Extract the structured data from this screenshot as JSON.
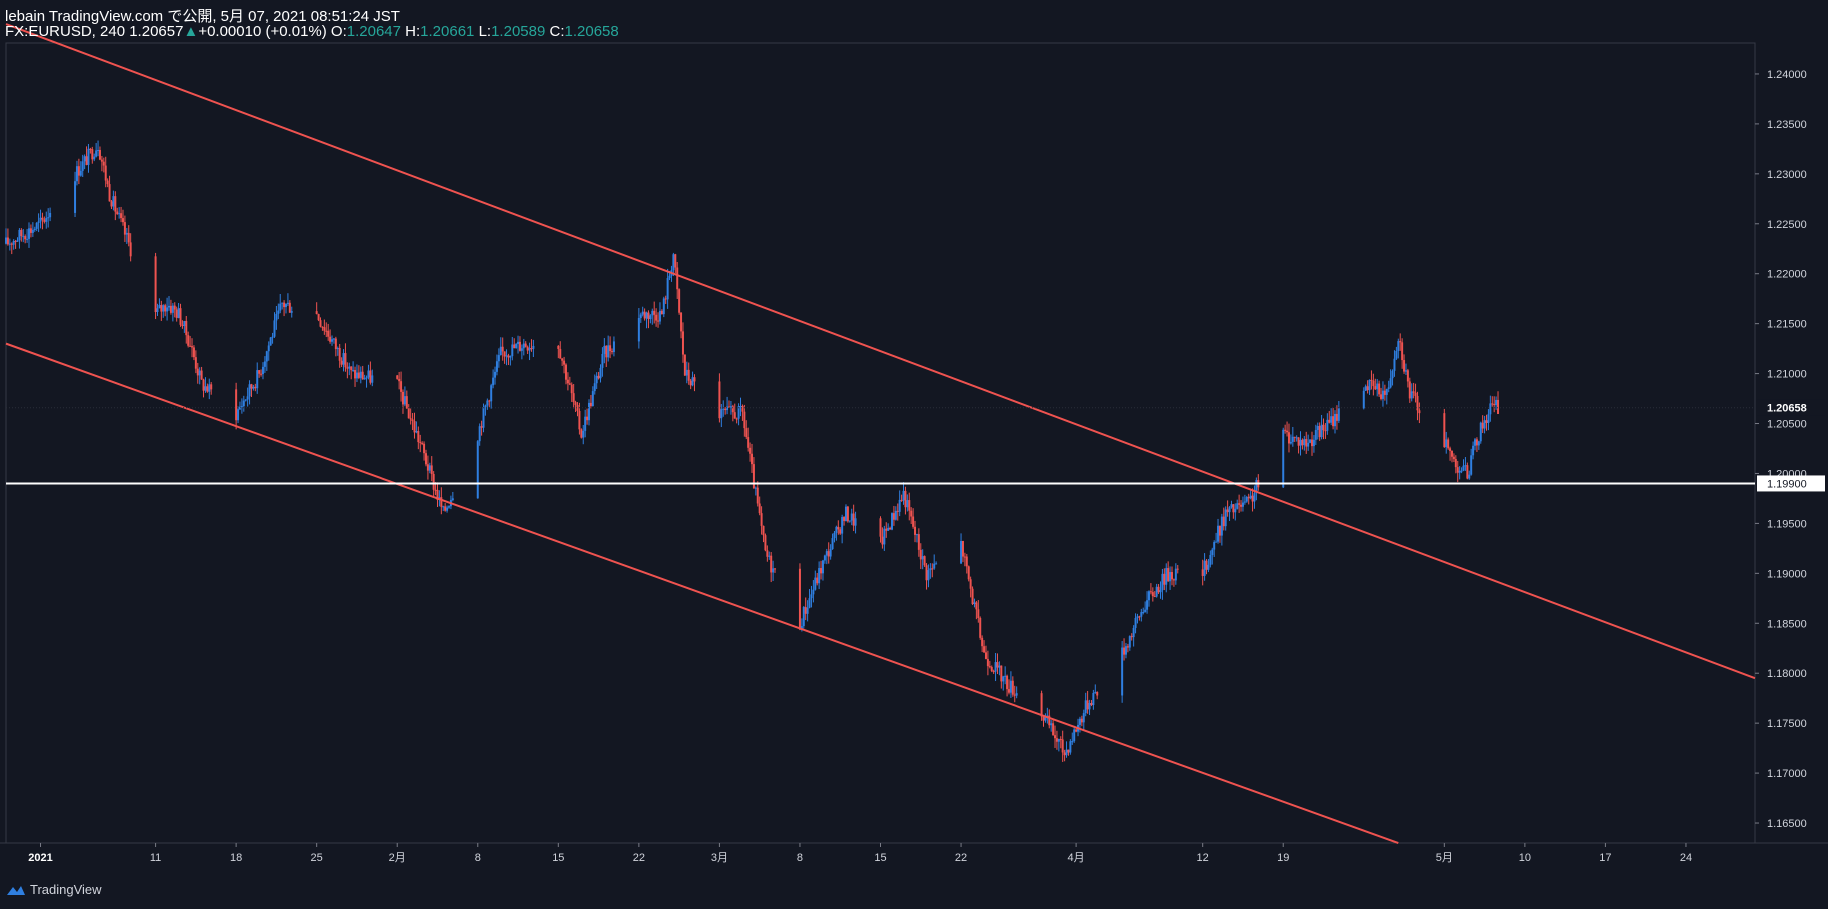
{
  "header": {
    "publisher_line": "lebain TradingView.com で公開, 5月 07, 2021 08:51:24 JST",
    "symbol": "FX:EURUSD, 240",
    "last": "1.20657",
    "arrow": "▲",
    "change": "+0.00010 (+0.01%)",
    "o_label": "O:",
    "o_value": "1.20647",
    "h_label": "H:",
    "h_value": "1.20661",
    "l_label": "L:",
    "l_value": "1.20589",
    "c_label": "C:",
    "c_value": "1.20658"
  },
  "footer": {
    "brand": "TradingView",
    "logo_icon": "tradingview-logo-icon"
  },
  "colors": {
    "background": "#131722",
    "up": "#2f7fe0",
    "down": "#ef5350",
    "channel": "#ef5350",
    "support": "#ffffff",
    "axis_text": "#d1d4dc",
    "header_up": "#26a69a"
  },
  "chart_data": {
    "type": "candlestick",
    "symbol": "FX:EURUSD",
    "timeframe": "240",
    "price_axis": {
      "ylim": [
        1.163,
        1.243
      ],
      "ticks": [
        "1.24000",
        "1.23500",
        "1.23000",
        "1.22500",
        "1.22000",
        "1.21500",
        "1.21000",
        "1.20500",
        "1.20000",
        "1.19500",
        "1.19000",
        "1.18500",
        "1.18000",
        "1.17500",
        "1.17000",
        "1.16500"
      ],
      "last_price_label": "1.20658",
      "support_label": "1.19900"
    },
    "time_axis": {
      "xlim": [
        "2020-12-29",
        "2021-05-30"
      ],
      "ticks": [
        {
          "date": "2021-01-01",
          "label": "2021",
          "bold": true
        },
        {
          "date": "2021-01-11",
          "label": "11"
        },
        {
          "date": "2021-01-18",
          "label": "18"
        },
        {
          "date": "2021-01-25",
          "label": "25"
        },
        {
          "date": "2021-02-01",
          "label": "2月"
        },
        {
          "date": "2021-02-08",
          "label": "8"
        },
        {
          "date": "2021-02-15",
          "label": "15"
        },
        {
          "date": "2021-02-22",
          "label": "22"
        },
        {
          "date": "2021-03-01",
          "label": "3月"
        },
        {
          "date": "2021-03-08",
          "label": "8"
        },
        {
          "date": "2021-03-15",
          "label": "15"
        },
        {
          "date": "2021-03-22",
          "label": "22"
        },
        {
          "date": "2021-04-01",
          "label": "4月"
        },
        {
          "date": "2021-04-12",
          "label": "12"
        },
        {
          "date": "2021-04-19",
          "label": "19"
        },
        {
          "date": "2021-05-03",
          "label": "5月"
        },
        {
          "date": "2021-05-10",
          "label": "10"
        },
        {
          "date": "2021-05-17",
          "label": "17"
        },
        {
          "date": "2021-05-24",
          "label": "24"
        }
      ]
    },
    "price_path": [
      {
        "date": "2020-12-29",
        "price": 1.223
      },
      {
        "date": "2021-01-01",
        "price": 1.225
      },
      {
        "date": "2021-01-04",
        "price": 1.23
      },
      {
        "date": "2021-01-06",
        "price": 1.233
      },
      {
        "date": "2021-01-07",
        "price": 1.228
      },
      {
        "date": "2021-01-08",
        "price": 1.225
      },
      {
        "date": "2021-01-11",
        "price": 1.216
      },
      {
        "date": "2021-01-12",
        "price": 1.217
      },
      {
        "date": "2021-01-13",
        "price": 1.216
      },
      {
        "date": "2021-01-14",
        "price": 1.213
      },
      {
        "date": "2021-01-15",
        "price": 1.209
      },
      {
        "date": "2021-01-18",
        "price": 1.206
      },
      {
        "date": "2021-01-20",
        "price": 1.21
      },
      {
        "date": "2021-01-22",
        "price": 1.217
      },
      {
        "date": "2021-01-25",
        "price": 1.216
      },
      {
        "date": "2021-01-28",
        "price": 1.21
      },
      {
        "date": "2021-02-01",
        "price": 1.209
      },
      {
        "date": "2021-02-03",
        "price": 1.203
      },
      {
        "date": "2021-02-05",
        "price": 1.196
      },
      {
        "date": "2021-02-08",
        "price": 1.204
      },
      {
        "date": "2021-02-10",
        "price": 1.212
      },
      {
        "date": "2021-02-12",
        "price": 1.213
      },
      {
        "date": "2021-02-15",
        "price": 1.213
      },
      {
        "date": "2021-02-17",
        "price": 1.204
      },
      {
        "date": "2021-02-19",
        "price": 1.212
      },
      {
        "date": "2021-02-22",
        "price": 1.216
      },
      {
        "date": "2021-02-24",
        "price": 1.216
      },
      {
        "date": "2021-02-25",
        "price": 1.222
      },
      {
        "date": "2021-02-26",
        "price": 1.21
      },
      {
        "date": "2021-03-01",
        "price": 1.206
      },
      {
        "date": "2021-03-03",
        "price": 1.206
      },
      {
        "date": "2021-03-05",
        "price": 1.192
      },
      {
        "date": "2021-03-08",
        "price": 1.185
      },
      {
        "date": "2021-03-10",
        "price": 1.191
      },
      {
        "date": "2021-03-12",
        "price": 1.196
      },
      {
        "date": "2021-03-15",
        "price": 1.193
      },
      {
        "date": "2021-03-17",
        "price": 1.198
      },
      {
        "date": "2021-03-19",
        "price": 1.19
      },
      {
        "date": "2021-03-22",
        "price": 1.193
      },
      {
        "date": "2021-03-24",
        "price": 1.182
      },
      {
        "date": "2021-03-26",
        "price": 1.179
      },
      {
        "date": "2021-03-29",
        "price": 1.176
      },
      {
        "date": "2021-03-31",
        "price": 1.172
      },
      {
        "date": "2021-04-02",
        "price": 1.177
      },
      {
        "date": "2021-04-05",
        "price": 1.182
      },
      {
        "date": "2021-04-07",
        "price": 1.187
      },
      {
        "date": "2021-04-09",
        "price": 1.19
      },
      {
        "date": "2021-04-12",
        "price": 1.19
      },
      {
        "date": "2021-04-14",
        "price": 1.196
      },
      {
        "date": "2021-04-16",
        "price": 1.197
      },
      {
        "date": "2021-04-19",
        "price": 1.204
      },
      {
        "date": "2021-04-21",
        "price": 1.203
      },
      {
        "date": "2021-04-23",
        "price": 1.205
      },
      {
        "date": "2021-04-26",
        "price": 1.209
      },
      {
        "date": "2021-04-28",
        "price": 1.208
      },
      {
        "date": "2021-04-29",
        "price": 1.214
      },
      {
        "date": "2021-04-30",
        "price": 1.208
      },
      {
        "date": "2021-05-03",
        "price": 1.203
      },
      {
        "date": "2021-05-04",
        "price": 1.201
      },
      {
        "date": "2021-05-05",
        "price": 1.2
      },
      {
        "date": "2021-05-06",
        "price": 1.204
      },
      {
        "date": "2021-05-07",
        "price": 1.2066
      }
    ],
    "drawings": [
      {
        "type": "trendline",
        "name": "channel-upper",
        "points": [
          {
            "date": "2020-12-29",
            "price": 1.245
          },
          {
            "date": "2021-05-30",
            "price": 1.1795
          }
        ]
      },
      {
        "type": "trendline",
        "name": "channel-lower",
        "points": [
          {
            "date": "2020-12-29",
            "price": 1.213
          },
          {
            "date": "2021-04-29",
            "price": 1.163
          }
        ]
      },
      {
        "type": "horizontal-line",
        "name": "support-line",
        "price": 1.199
      }
    ],
    "grid": false,
    "legend": "none"
  }
}
